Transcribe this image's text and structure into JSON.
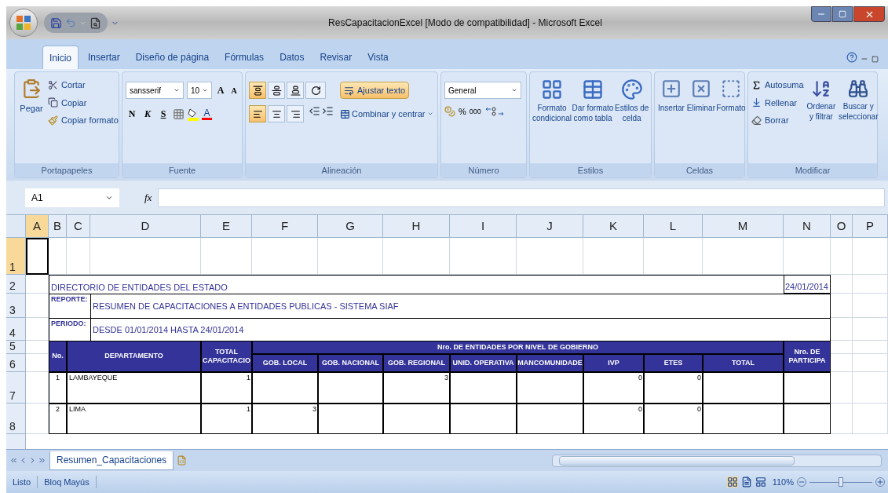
{
  "window": {
    "title": "ResCapacitacionExcel  [Modo de compatibilidad] - Microsoft Excel"
  },
  "ribbon_tabs": [
    {
      "label": "Inicio",
      "selected": true
    },
    {
      "label": "Insertar",
      "selected": false
    },
    {
      "label": "Diseño de página",
      "selected": false
    },
    {
      "label": "Fórmulas",
      "selected": false
    },
    {
      "label": "Datos",
      "selected": false
    },
    {
      "label": "Revisar",
      "selected": false
    },
    {
      "label": "Vista",
      "selected": false
    }
  ],
  "clipboard": {
    "paste": "Pegar",
    "cut": "Cortar",
    "copy": "Copiar",
    "format_painter": "Copiar formato",
    "label": "Portapapeles"
  },
  "font": {
    "name": "sansserif",
    "size": "10",
    "grow": "A",
    "shrink": "A",
    "bold": "N",
    "italic": "K",
    "underline": "S",
    "font_color": "A",
    "label": "Fuente"
  },
  "alignment": {
    "vertical": [
      {
        "selected": true
      },
      {
        "selected": false
      },
      {
        "selected": false
      }
    ],
    "horizontal": [
      {
        "selected": true
      },
      {
        "selected": false
      },
      {
        "selected": false
      }
    ],
    "wrap_text": {
      "label": "Ajustar texto",
      "on": true
    },
    "merge": "Combinar y centrar",
    "label": "Alineación"
  },
  "number": {
    "format": "General",
    "percent": "%",
    "thousands": "000",
    "label": "Número"
  },
  "styles": {
    "buttons": [
      [
        "Formato",
        "condicional"
      ],
      [
        "Dar formato",
        "como tabla"
      ],
      [
        "Estilos de",
        "celda"
      ]
    ],
    "label": "Estilos"
  },
  "cells": {
    "buttons": [
      "Insertar",
      "Eliminar",
      "Formato"
    ],
    "label": "Celdas"
  },
  "editing": {
    "autosum": "Autosuma",
    "fill": "Rellenar",
    "clear": "Borrar",
    "sort": [
      "Ordenar",
      "y filtrar"
    ],
    "find": [
      "Buscar y",
      "seleccionar"
    ],
    "label": "Modificar"
  },
  "formula_bar": {
    "name_box": "A1",
    "function_label": "fx"
  },
  "columns": [
    {
      "label": "A",
      "selected": true
    },
    {
      "label": "B",
      "selected": false
    },
    {
      "label": "C",
      "selected": false
    },
    {
      "label": "D",
      "selected": false
    },
    {
      "label": "E",
      "selected": false
    },
    {
      "label": "F",
      "selected": false
    },
    {
      "label": "G",
      "selected": false
    },
    {
      "label": "H",
      "selected": false
    },
    {
      "label": "I",
      "selected": false
    },
    {
      "label": "J",
      "selected": false
    },
    {
      "label": "K",
      "selected": false
    },
    {
      "label": "L",
      "selected": false
    },
    {
      "label": "M",
      "selected": false
    },
    {
      "label": "N",
      "selected": false
    },
    {
      "label": "O",
      "selected": false
    },
    {
      "label": "P",
      "selected": false
    }
  ],
  "rows": [
    {
      "label": "1",
      "selected": true
    },
    {
      "label": "2",
      "selected": false
    },
    {
      "label": "3",
      "selected": false
    },
    {
      "label": "4",
      "selected": false
    },
    {
      "label": "5",
      "selected": false
    },
    {
      "label": "6",
      "selected": false
    },
    {
      "label": "7",
      "selected": false
    },
    {
      "label": "8",
      "selected": false
    }
  ],
  "report": {
    "title": "DIRECTORIO DE ENTIDADES DEL ESTADO",
    "date": "24/01/2014",
    "reporte_label": "REPORTE:",
    "reporte_value": "RESUMEN DE CAPACITACIONES A ENTIDADES PUBLICAS - SISTEMA SIAF",
    "periodo_label": "PERIODO:",
    "periodo_value": "DESDE 01/01/2014 HASTA 24/01/2014"
  },
  "table": {
    "no_header": "No.",
    "department_header": "DEPARTAMENTO",
    "total_header": "TOTAL CAPACITACIO",
    "group_header": "Nro. DE ENTIDADES POR NIVEL DE GOBIERNO",
    "participants_header": "Nro. DE PARTICIPA",
    "columns": [
      "GOB. LOCAL",
      "GOB. NACIONAL",
      "GOB. REGIONAL",
      "UNID. OPERATIVA",
      "MANCOMUNIDADE",
      "IVP",
      "ETES",
      "TOTAL"
    ],
    "rows": [
      {
        "no": "1",
        "department": "LAMBAYEQUE",
        "total_capacitacio": "1",
        "values": [
          {
            "kind": "blank"
          },
          {
            "kind": "blank"
          },
          {
            "kind": "value",
            "text": "3"
          },
          {
            "kind": "blank"
          },
          {
            "kind": "blank"
          },
          {
            "kind": "value",
            "text": "0"
          },
          {
            "kind": "value",
            "text": "0"
          },
          {
            "kind": "blank"
          }
        ]
      },
      {
        "no": "2",
        "department": "LIMA",
        "total_capacitacio": "1",
        "values": [
          {
            "kind": "value",
            "text": "3"
          },
          {
            "kind": "blank"
          },
          {
            "kind": "blank"
          },
          {
            "kind": "blank"
          },
          {
            "kind": "blank"
          },
          {
            "kind": "value",
            "text": "0"
          },
          {
            "kind": "value",
            "text": "0"
          },
          {
            "kind": "blank"
          }
        ]
      }
    ]
  },
  "sheet_tabs": [
    {
      "label": "Resumen_Capacitaciones",
      "selected": true
    }
  ],
  "status_bar": {
    "items": [
      "Listo",
      "Bloq Mayús"
    ],
    "zoom": "110%",
    "zoom_slider": {
      "level": 0.5
    }
  }
}
